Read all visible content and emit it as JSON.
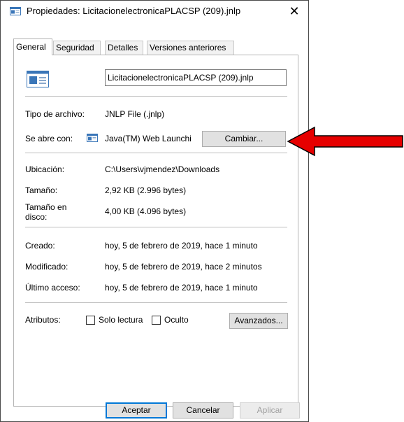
{
  "window": {
    "title": "Propiedades: LicitacionelectronicaPLACSP (209).jnlp",
    "close_glyph": "✕"
  },
  "tabs": [
    "General",
    "Seguridad",
    "Detalles",
    "Versiones anteriores"
  ],
  "general": {
    "file_name": "LicitacionelectronicaPLACSP (209).jnlp",
    "type_label": "Tipo de archivo:",
    "type_value": "JNLP File (.jnlp)",
    "opens_label": "Se abre con:",
    "opens_value": "Java(TM) Web Launchi",
    "change_button": "Cambiar...",
    "location_label": "Ubicación:",
    "location_value": "C:\\Users\\vjmendez\\Downloads",
    "size_label": "Tamaño:",
    "size_value": "2,92 KB (2.996 bytes)",
    "disk_label_1": "Tamaño en",
    "disk_label_2": "disco:",
    "disk_value": "4,00 KB (4.096 bytes)",
    "created_label": "Creado:",
    "created_value": "hoy, 5 de febrero de 2019, hace 1 minuto",
    "modified_label": "Modificado:",
    "modified_value": "hoy, 5 de febrero de 2019, hace 2 minutos",
    "accessed_label": "Último acceso:",
    "accessed_value": "hoy, 5 de febrero de 2019, hace 1 minuto",
    "attributes_label": "Atributos:",
    "readonly_label": "Solo lectura",
    "readonly_checked": false,
    "hidden_label": "Oculto",
    "hidden_checked": false,
    "advanced_button": "Avanzados..."
  },
  "footer": {
    "ok": "Aceptar",
    "cancel": "Cancelar",
    "apply": "Aplicar"
  },
  "colors": {
    "arrow_fill": "#e60000",
    "accent": "#0078d7"
  },
  "icons": {
    "title": "jnlp-file-icon",
    "file": "jnlp-file-icon-large",
    "app": "java-launcher-icon",
    "annotation": "red-arrow-icon"
  }
}
